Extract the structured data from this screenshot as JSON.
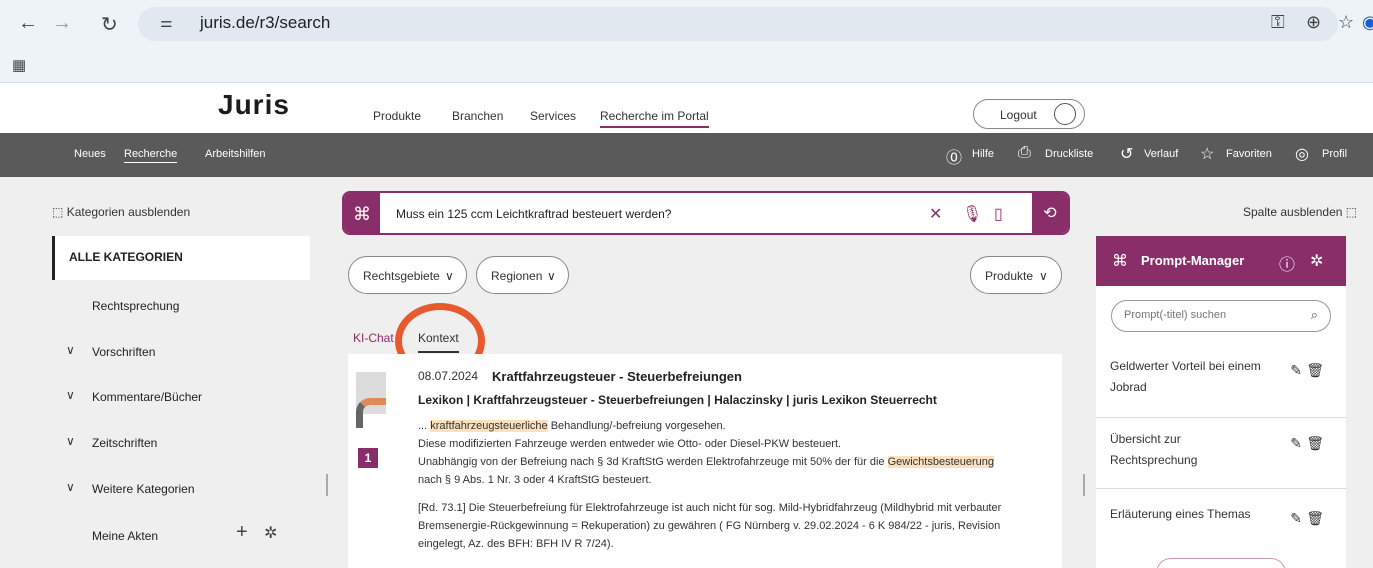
{
  "browser": {
    "url": "juris.de/r3/search",
    "icons": [
      "back-arrow-icon",
      "forward-arrow-icon",
      "reload-icon",
      "site-info-icon",
      "key-icon",
      "zoom-icon",
      "star-icon",
      "profile-icon",
      "apps-grid-icon"
    ]
  },
  "header": {
    "logo": "Juris",
    "nav": [
      "Produkte",
      "Branchen",
      "Services",
      "Recherche im Portal"
    ],
    "logout": "Logout"
  },
  "toolbar": {
    "left": [
      "Neues",
      "Recherche",
      "Arbeitshilfen"
    ],
    "right": [
      "Hilfe",
      "Druckliste",
      "Verlauf",
      "Favoriten",
      "Profil"
    ]
  },
  "sidebar": {
    "toggle": "Kategorien ausblenden",
    "items": [
      "ALLE KATEGORIEN",
      "Rechtsprechung",
      "Vorschriften",
      "Kommentare/Bücher",
      "Zeitschriften",
      "Weitere Kategorien",
      "Meine Akten"
    ]
  },
  "search": {
    "query": "Muss ein 125 ccm Leichtkraftrad besteuert werden?"
  },
  "filters": {
    "rechtsgebiete": "Rechtsgebiete",
    "regionen": "Regionen",
    "produkte": "Produkte"
  },
  "tabs": {
    "chat": "KI-Chat",
    "context": "Kontext"
  },
  "result": {
    "number": "1",
    "date": "08.07.2024",
    "title": "Kraftfahrzeugsteuer - Steuerbefreiungen",
    "subtitle": "Lexikon | Kraftfahrzeugsteuer - Steuerbefreiungen | Halaczinsky | juris Lexikon Steuerrecht",
    "line1_pre": "...",
    "line1_hl": "kraftfahrzeugsteuerliche",
    "line1_post": "Behandlung/-befreiung vorgesehen.",
    "line2": "Diese modifizierten Fahrzeuge werden entweder wie Otto- oder Diesel-PKW besteuert.",
    "line3_pre": "Unabhängig von der Befreiung nach § 3d KraftStG werden Elektrofahrzeuge mit 50% der für die",
    "line3_hl": "Gewichtsbesteuerung",
    "line4": "nach § 9 Abs. 1 Nr. 3 oder 4 KraftStG besteuert.",
    "line5": "[Rd. 73.1] Die Steuerbefreiung für Elektrofahrzeuge ist auch nicht für sog. Mild-Hybridfahrzeug (Mildhybrid mit verbauter",
    "line6": "Bremsenergie-Rückgewinnung = Rekuperation) zu gewähren ( FG Nürnberg v. 29.02.2024 - 6 K 984/22 - juris, Revision",
    "line7": "eingelegt, Az. des BFH: BFH IV R 7/24)."
  },
  "prompt_manager": {
    "column_toggle": "Spalte ausblenden",
    "title": "Prompt-Manager",
    "search_placeholder": "Prompt(-titel) suchen",
    "items": [
      "Geldwerter Vorteil bei einem Jobrad",
      "Übersicht zur Rechtsprechung",
      "Erläuterung eines Themas"
    ]
  },
  "colors": {
    "accent": "#8a2e6a",
    "toolbar": "#5a5a5a",
    "highlight": "#fae0bd",
    "annotation_ring": "#e85a2e"
  }
}
